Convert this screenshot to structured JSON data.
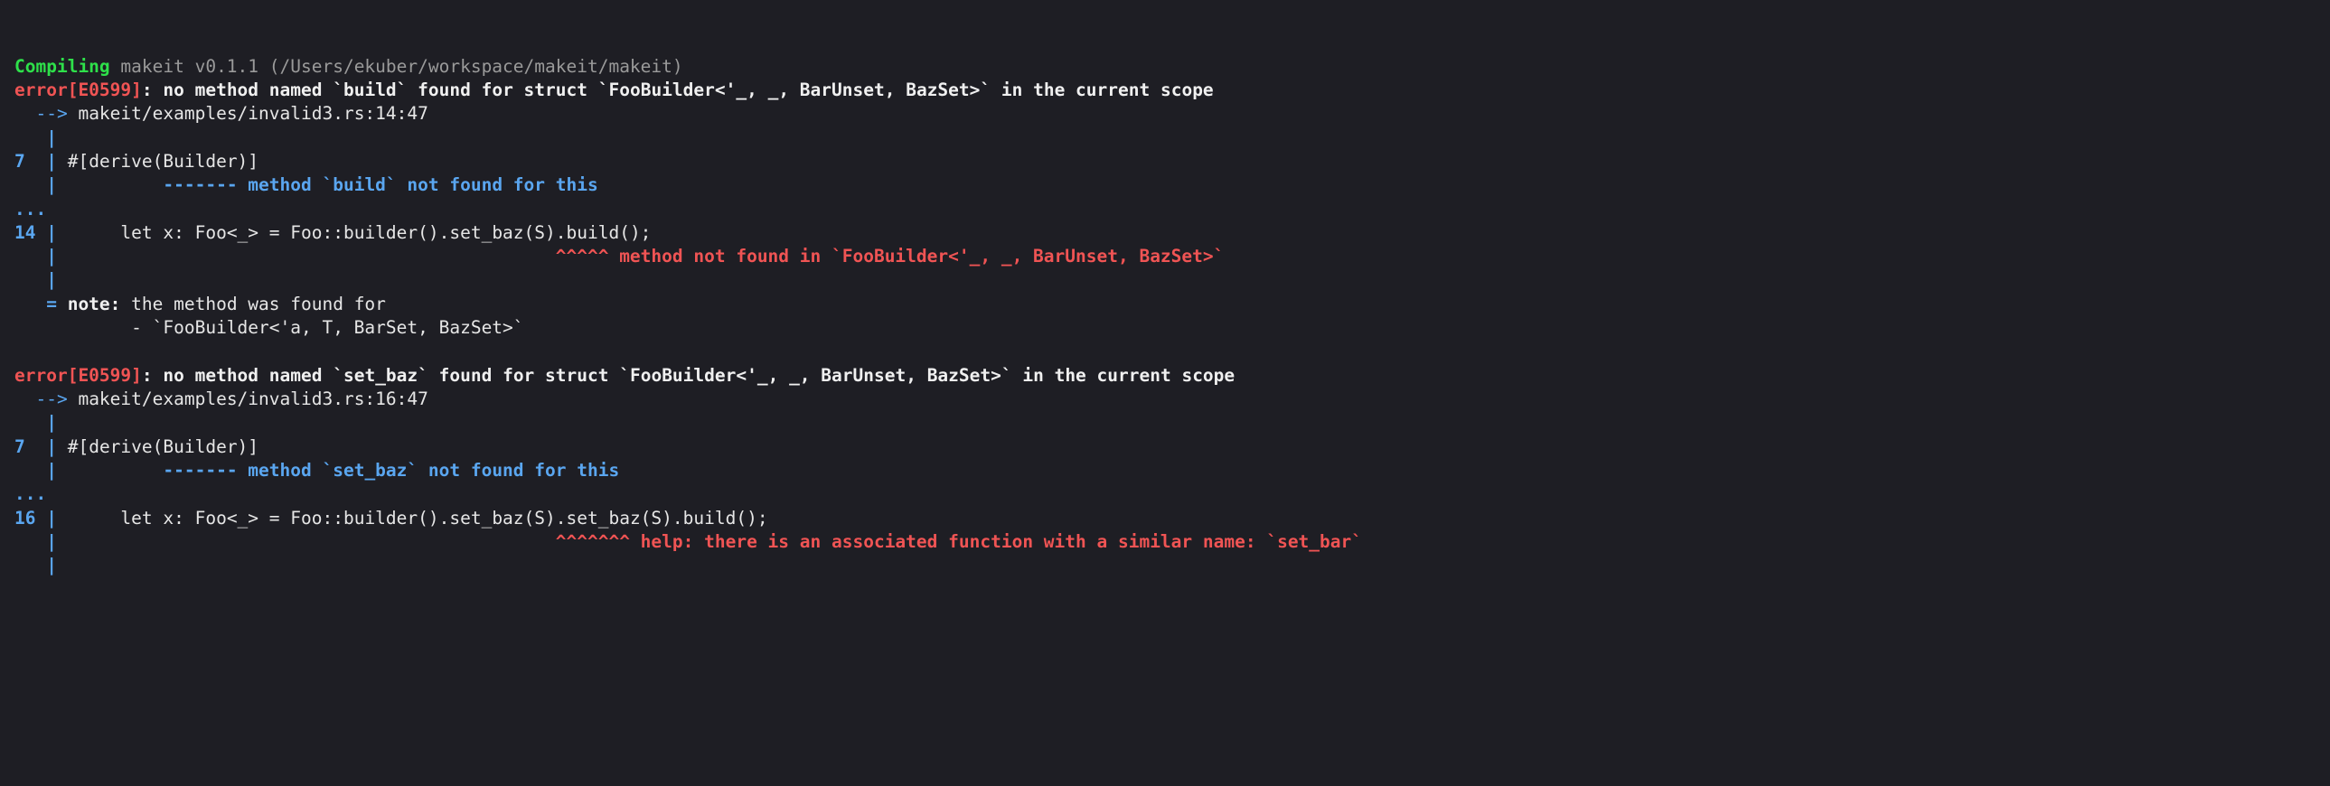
{
  "top_truncated": {
    "compiling_word": "Compiling",
    "rest": " makeit v0.1.1 (/Users/ekuber/workspace/makeit/makeit)"
  },
  "error1": {
    "prefix": "error",
    "code": "[E0599]",
    "colon": ": ",
    "msg_pre": "no method named `",
    "method": "build",
    "msg_mid": "` found for struct `",
    "struct": "FooBuilder<'_, _, BarUnset, BazSet>",
    "msg_post": "` in the current scope",
    "arrow": "  --> ",
    "loc": "makeit/examples/invalid3.rs:14:47",
    "gutter_blank": "   | ",
    "ln7": "7 ",
    "pipe": " | ",
    "src7": "#[derive(Builder)]",
    "ul7_pad": "   |          ",
    "ul7_dash": "-------",
    "ul7_msg": " method `build` not found for this",
    "dots": "...",
    "ln14": "14",
    "src14": "     let x: Foo<_> = Foo::builder().set_baz(S).build();",
    "caret14_pad": "   |                                               ",
    "caret14": "^^^^^",
    "caret14_msg": " method not found in `FooBuilder<'_, _, BarUnset, BazSet>`",
    "note_gut": "   = ",
    "note_label": "note: ",
    "note_text": "the method was found for",
    "note_item_gut": "           - ",
    "note_item": "`FooBuilder<'a, T, BarSet, BazSet>`"
  },
  "error2": {
    "prefix": "error",
    "code": "[E0599]",
    "colon": ": ",
    "msg_pre": "no method named `",
    "method": "set_baz",
    "msg_mid": "` found for struct `",
    "struct": "FooBuilder<'_, _, BarUnset, BazSet>",
    "msg_post": "` in the current scope",
    "arrow": "  --> ",
    "loc": "makeit/examples/invalid3.rs:16:47",
    "gutter_blank": "   | ",
    "ln7": "7 ",
    "pipe": " | ",
    "src7": "#[derive(Builder)]",
    "ul7_pad": "   |          ",
    "ul7_dash": "-------",
    "ul7_msg": " method `set_baz` not found for this",
    "dots": "...",
    "ln16": "16",
    "src16": "     let x: Foo<_> = Foo::builder().set_baz(S).set_baz(S).build();",
    "caret16_pad": "   |                                               ",
    "caret16": "^^^^^^^",
    "caret16_msg": " help: there is an associated function with a similar name: `set_bar`"
  }
}
